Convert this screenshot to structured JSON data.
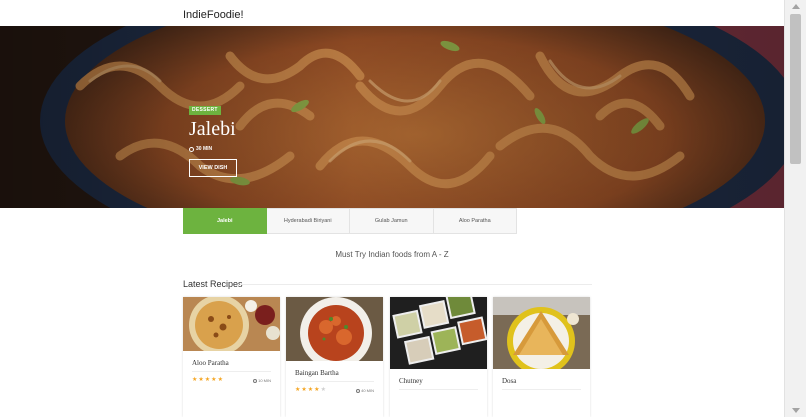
{
  "header": {
    "brand": "IndieFoodie!"
  },
  "hero": {
    "badge": "DESSERT",
    "title": "Jalebi",
    "time": "30 MIN",
    "button": "VIEW DISH"
  },
  "tabs": [
    {
      "label": "Jalebi",
      "active": true
    },
    {
      "label": "Hyderabadi Biriyani",
      "active": false
    },
    {
      "label": "Gulab Jamun",
      "active": false
    },
    {
      "label": "Aloo Paratha",
      "active": false
    }
  ],
  "tagline": "Must Try Indian foods from A - Z",
  "latest": {
    "title": "Latest Recipes",
    "cards": [
      {
        "name": "Aloo Paratha",
        "rating": 5,
        "max_rating": 5,
        "time": "10 MIN"
      },
      {
        "name": "Baingan Bartha",
        "rating": 4,
        "max_rating": 5,
        "time": "40 MIN"
      },
      {
        "name": "Chutney"
      },
      {
        "name": "Dosa"
      }
    ]
  },
  "colors": {
    "accent": "#6db33f",
    "star": "#f5a623"
  }
}
